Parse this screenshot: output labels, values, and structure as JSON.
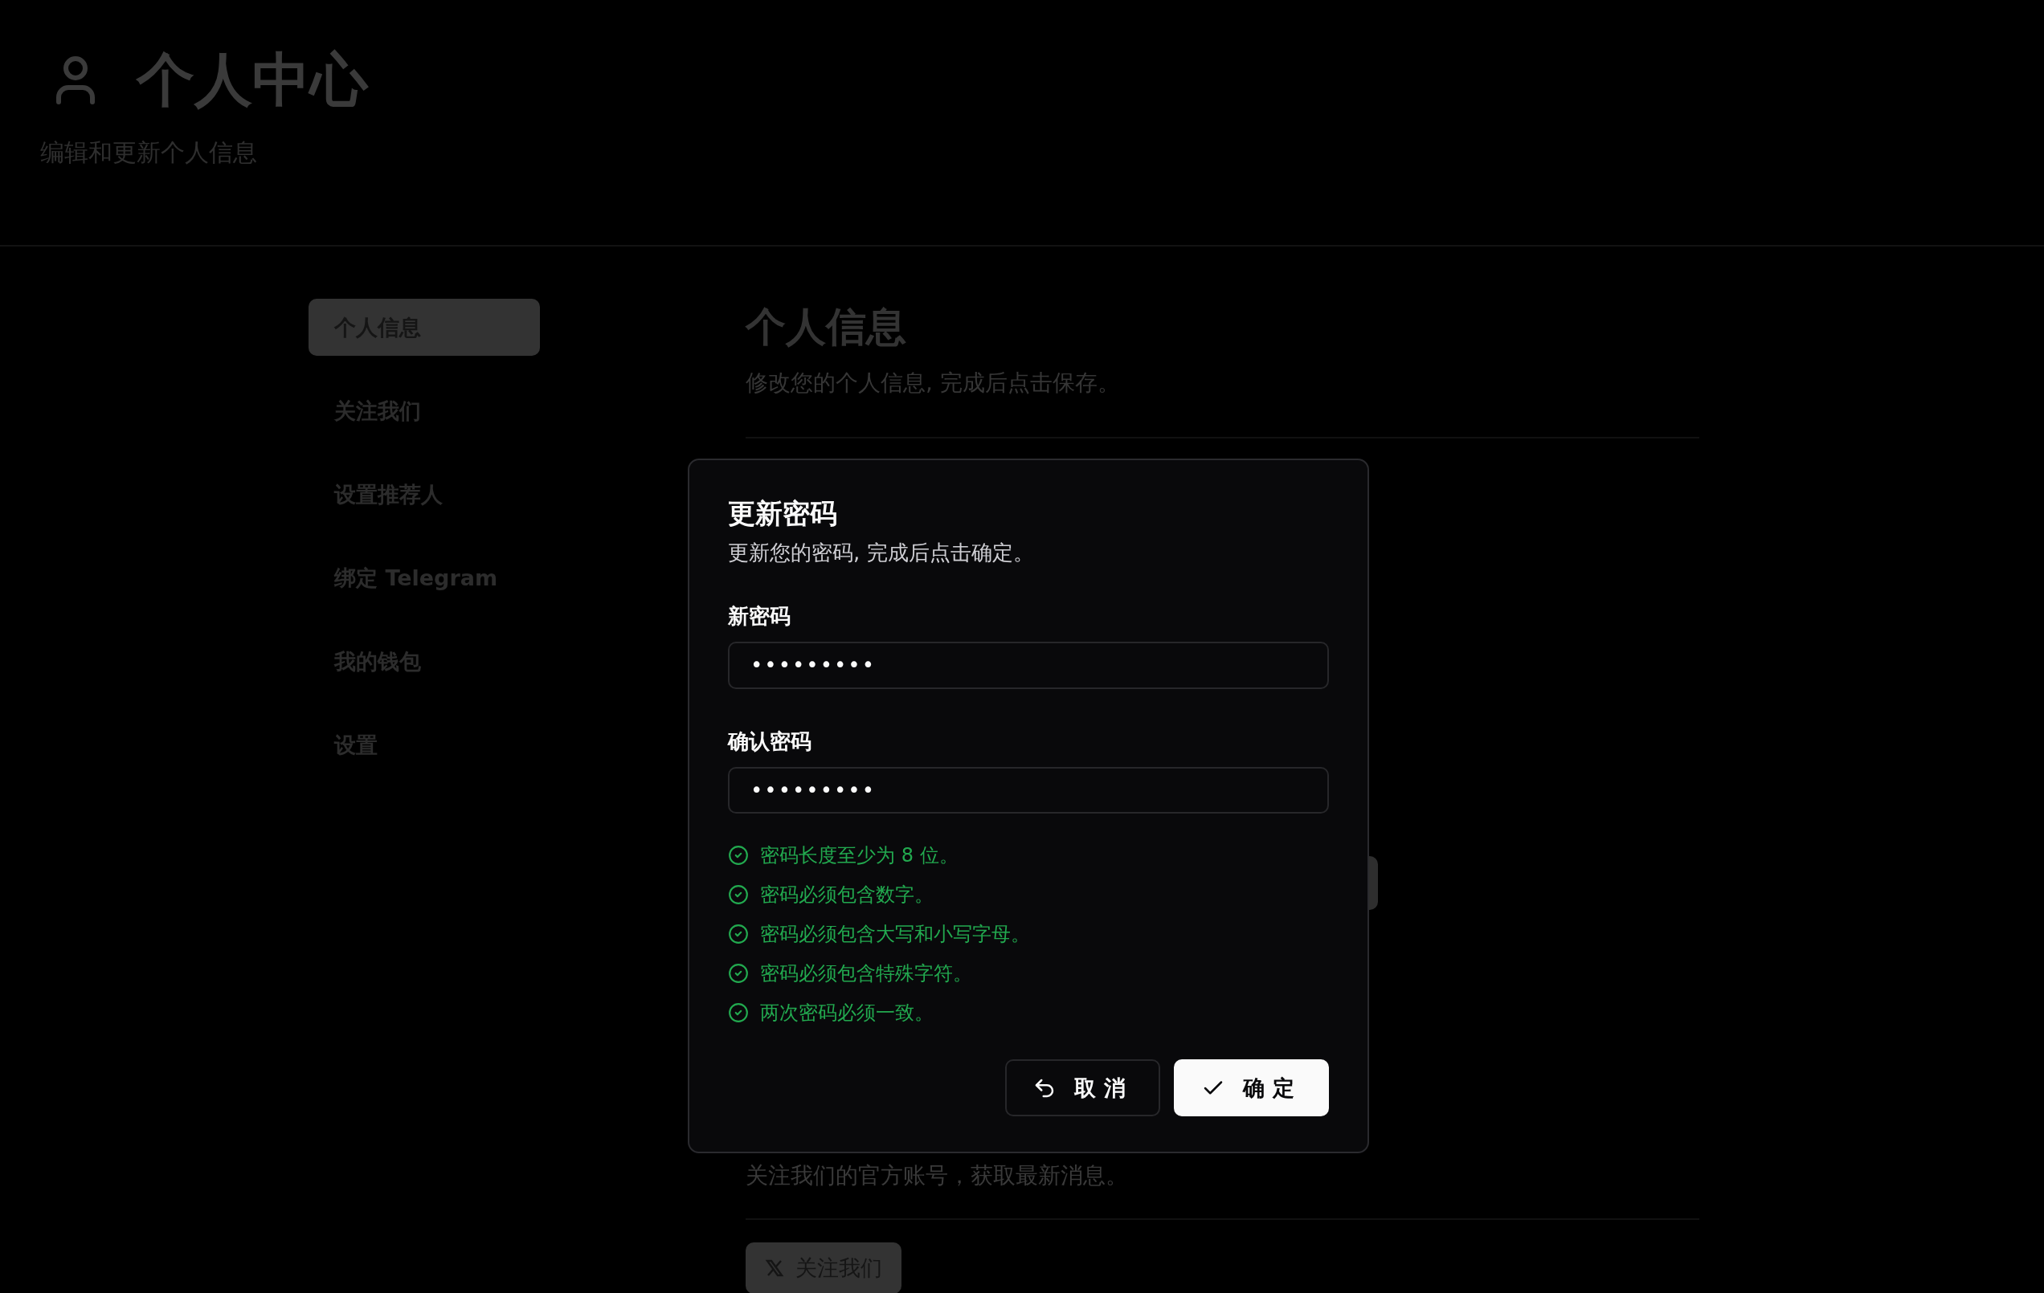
{
  "header": {
    "title": "个人中心",
    "subtitle": "编辑和更新个人信息"
  },
  "sidebar": {
    "items": [
      {
        "label": "个人信息",
        "selected": true
      },
      {
        "label": "关注我们",
        "selected": false
      },
      {
        "label": "设置推荐人",
        "selected": false
      },
      {
        "label": "绑定 Telegram",
        "selected": false
      },
      {
        "label": "我的钱包",
        "selected": false
      },
      {
        "label": "设置",
        "selected": false
      }
    ]
  },
  "main": {
    "profile": {
      "title": "个人信息",
      "description": "修改您的个人信息, 完成后点击保存。"
    },
    "follow": {
      "description": "关注我们的官方账号，获取最新消息。",
      "button": "关注我们"
    }
  },
  "dialog": {
    "title": "更新密码",
    "description": "更新您的密码, 完成后点击确定。",
    "fields": [
      {
        "label": "新密码",
        "value": "•••••••••"
      },
      {
        "label": "确认密码",
        "value": "•••••••••"
      }
    ],
    "requirements": [
      {
        "text": "密码长度至少为 8 位。",
        "met": true
      },
      {
        "text": "密码必须包含数字。",
        "met": true
      },
      {
        "text": "密码必须包含大写和小写字母。",
        "met": true
      },
      {
        "text": "密码必须包含特殊字符。",
        "met": true
      },
      {
        "text": "两次密码必须一致。",
        "met": true
      }
    ],
    "buttons": [
      {
        "kind": "cancel",
        "label": "取消"
      },
      {
        "kind": "confirm",
        "label": "确定"
      }
    ]
  }
}
